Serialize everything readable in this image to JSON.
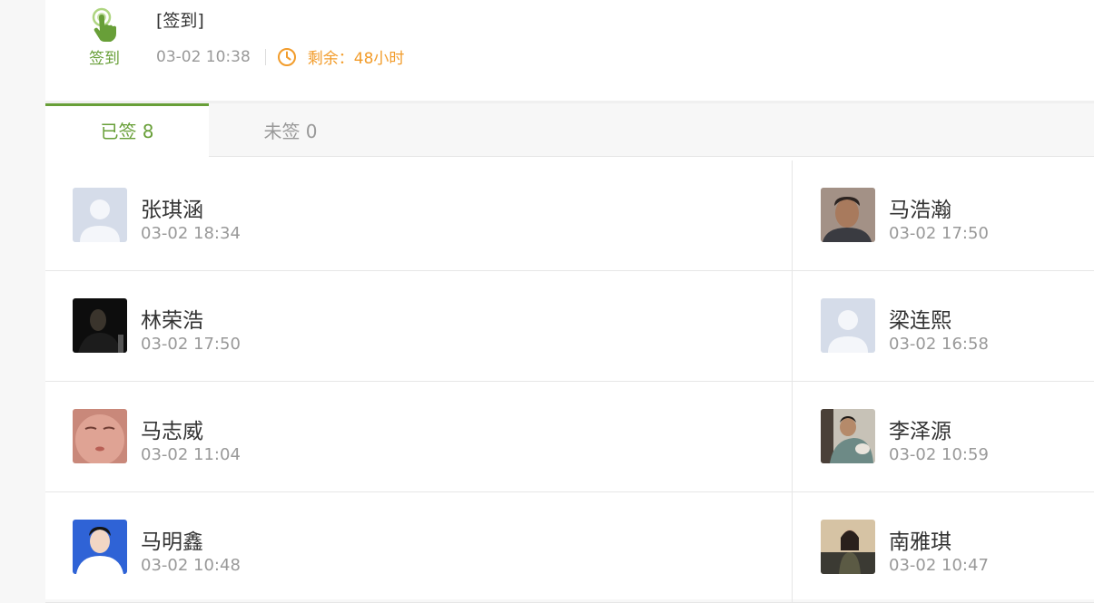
{
  "activity": {
    "type_label": "签到",
    "title": "[签到]",
    "datetime": "03-02 10:38",
    "remaining": "剩余：48小时",
    "accent_color": "#689f38",
    "remaining_color": "#f29c2b"
  },
  "tabs": [
    {
      "label": "已签 8",
      "active": true
    },
    {
      "label": "未签 0",
      "active": false
    }
  ],
  "signed_list": [
    {
      "name": "张琪涵",
      "time": "03-02 18:34",
      "avatar": "default-avatar"
    },
    {
      "name": "马浩瀚",
      "time": "03-02 17:50",
      "avatar": "photo-avatar"
    },
    {
      "name": "林荣浩",
      "time": "03-02 17:50",
      "avatar": "photo-avatar"
    },
    {
      "name": "梁连熙",
      "time": "03-02 16:58",
      "avatar": "default-avatar"
    },
    {
      "name": "马志威",
      "time": "03-02 11:04",
      "avatar": "photo-avatar"
    },
    {
      "name": "李泽源",
      "time": "03-02 10:59",
      "avatar": "photo-avatar"
    },
    {
      "name": "马明鑫",
      "time": "03-02 10:48",
      "avatar": "photo-avatar"
    },
    {
      "name": "南雅琪",
      "time": "03-02 10:47",
      "avatar": "photo-avatar"
    }
  ]
}
